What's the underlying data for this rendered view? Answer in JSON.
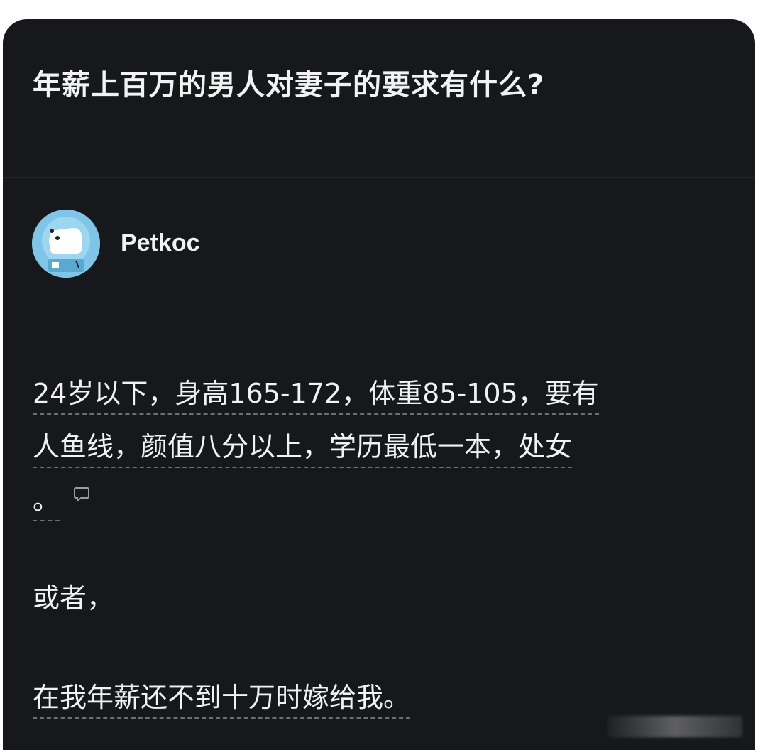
{
  "question": {
    "title": "年薪上百万的男人对妻子的要求有什么?"
  },
  "answer": {
    "author_name": "Petkoc",
    "avatar_icon": "dog-astronaut-avatar",
    "line1": "24岁以下，身高165-172，体重85-105，要有",
    "line2": "人鱼线，颜值八分以上，学历最低一本，处女",
    "line3": "。",
    "comment_icon": "comment-bubble-icon",
    "line4": "或者，",
    "line5": "在我年薪还不到十万时嫁给我。"
  },
  "colors": {
    "background": "#17181c",
    "text": "#f2f2f2",
    "avatar": "#7ec5e8",
    "underline": "#6d6f75"
  }
}
